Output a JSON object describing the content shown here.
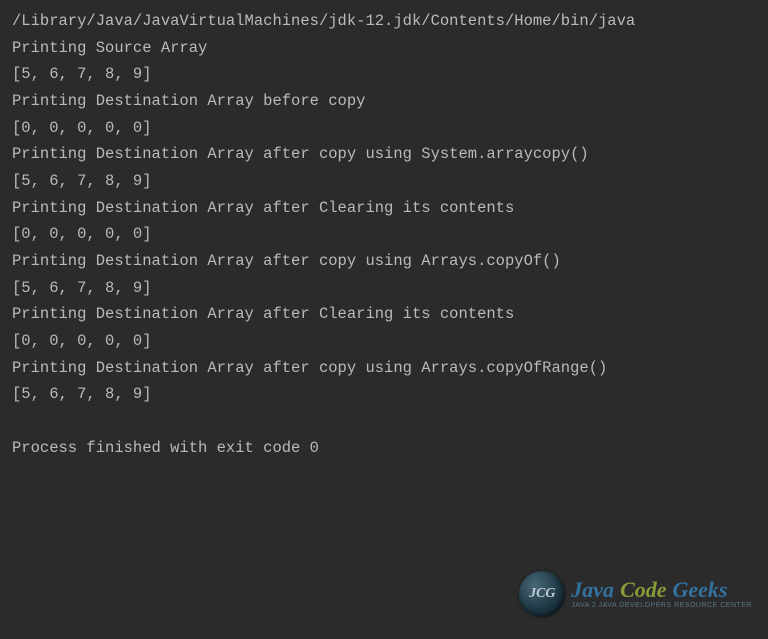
{
  "console": {
    "lines": [
      "/Library/Java/JavaVirtualMachines/jdk-12.jdk/Contents/Home/bin/java",
      "Printing Source Array",
      "[5, 6, 7, 8, 9]",
      "Printing Destination Array before copy",
      "[0, 0, 0, 0, 0]",
      "Printing Destination Array after copy using System.arraycopy()",
      "[5, 6, 7, 8, 9]",
      "Printing Destination Array after Clearing its contents",
      "[0, 0, 0, 0, 0]",
      "Printing Destination Array after copy using Arrays.copyOf()",
      "[5, 6, 7, 8, 9]",
      "Printing Destination Array after Clearing its contents",
      "[0, 0, 0, 0, 0]",
      "Printing Destination Array after copy using Arrays.copyOfRange()",
      "[5, 6, 7, 8, 9]",
      "",
      "Process finished with exit code 0"
    ]
  },
  "watermark": {
    "badge": "JCG",
    "words": {
      "java": "Java",
      "code": "Code",
      "geeks": "Geeks"
    },
    "tagline": "Java 2 Java Developers Resource Center"
  }
}
